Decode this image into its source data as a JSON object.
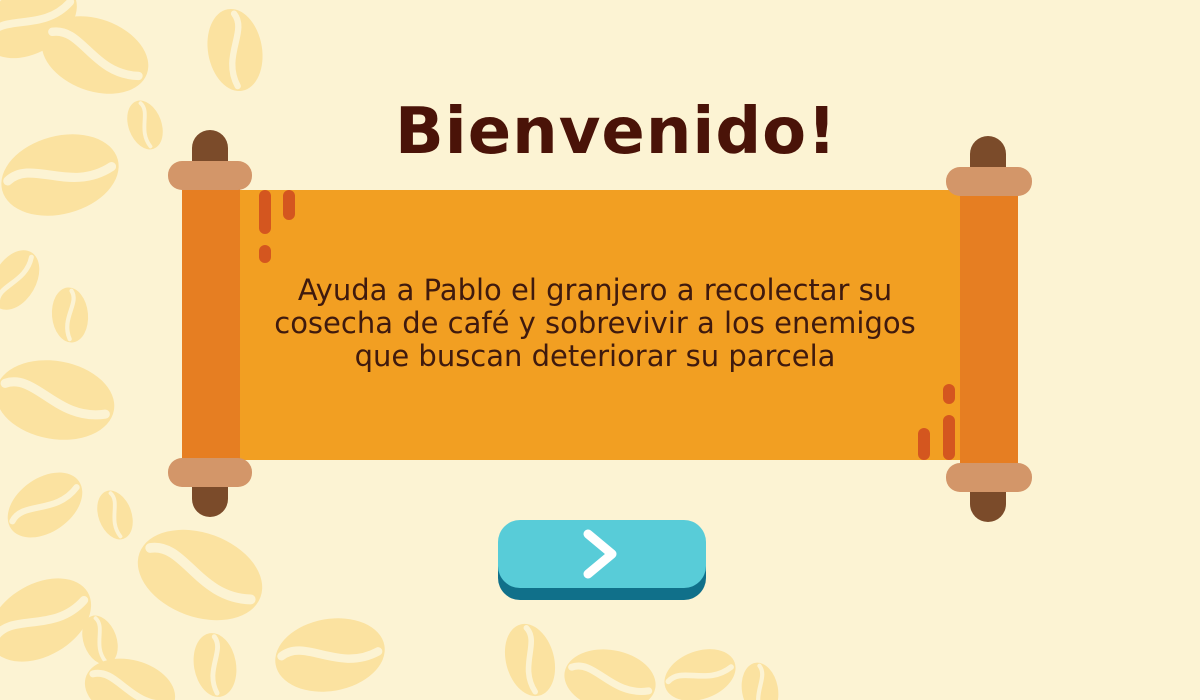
{
  "screen": {
    "title": "Bienvenido!",
    "message": "Ayuda a Pablo el granjero a recolectar su cosecha de café y sobrevivir a los enemigos que buscan deteriorar su parcela"
  },
  "next_button": {
    "icon": "chevron-right-icon"
  },
  "colors": {
    "background": "#fcf3d3",
    "bean": "#fbe2a0",
    "scroll_paper": "#f29f22",
    "scroll_roll": "#e67e22",
    "scroll_cap": "#d39669",
    "scroll_knob": "#7b4b2a",
    "accent_marks": "#d4561f",
    "title_text": "#4a1308",
    "button_face": "#58ccd8",
    "button_shadow": "#10708a"
  }
}
